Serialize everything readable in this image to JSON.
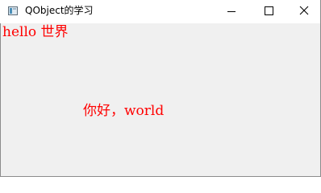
{
  "window": {
    "title": "QObject的学习"
  },
  "icons": {
    "app": "app-window-icon",
    "minimize": "minimize-icon",
    "maximize": "maximize-icon",
    "close": "close-icon"
  },
  "labels": {
    "top": "hello 世界",
    "center": "你好，world"
  },
  "colors": {
    "label_text": "#ff0000",
    "client_background": "#f0f0f0",
    "titlebar_background": "#ffffff"
  }
}
